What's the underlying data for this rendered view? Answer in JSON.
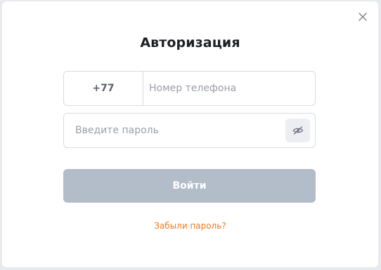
{
  "modal": {
    "title": "Авторизация",
    "close_icon": "close-icon"
  },
  "phone": {
    "country_code": "+77",
    "placeholder": "Номер телефона",
    "value": ""
  },
  "password": {
    "placeholder": "Введите пароль",
    "value": "",
    "toggle_icon": "eye-off-icon"
  },
  "login_button": {
    "label": "Войти",
    "state": "disabled"
  },
  "forgot_password": {
    "label": "Забыли пароль?"
  },
  "colors": {
    "accent": "#f07a1c",
    "button_disabled": "#b3bcc9",
    "border": "#d9dbe2"
  }
}
